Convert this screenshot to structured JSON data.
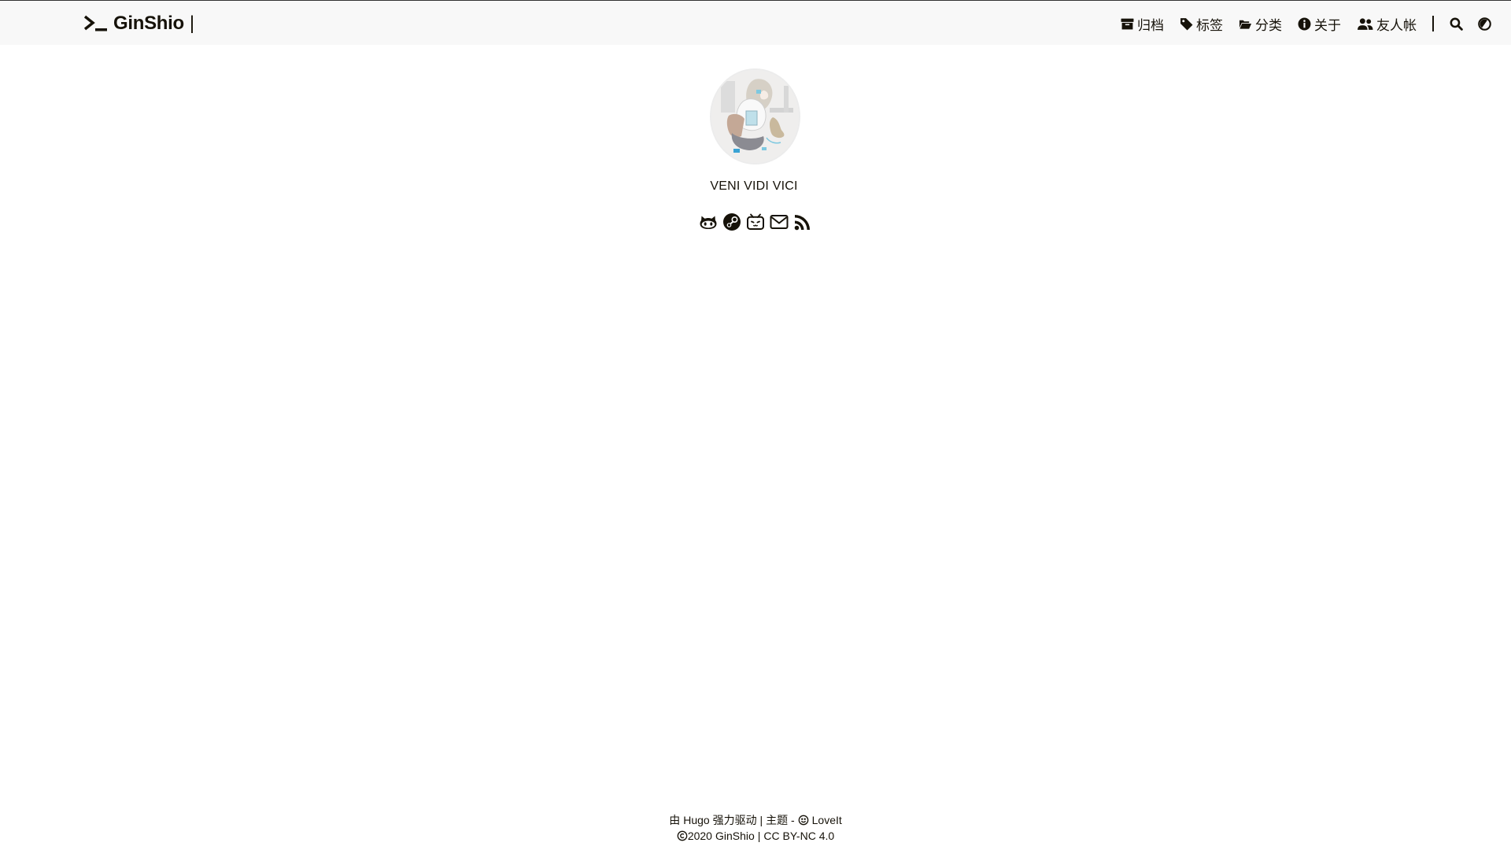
{
  "header": {
    "logo_text": "GinShio",
    "logo_caret": "|",
    "menu": [
      {
        "label": "归档",
        "icon": "archive-icon"
      },
      {
        "label": "标签",
        "icon": "tag-icon"
      },
      {
        "label": "分类",
        "icon": "folder-open-icon"
      },
      {
        "label": "关于",
        "icon": "info-icon"
      },
      {
        "label": "友人帐",
        "icon": "users-icon"
      }
    ],
    "search_icon": "search-icon",
    "theme_icon": "adjust-icon"
  },
  "profile": {
    "subtitle": "VENI VIDI VICI",
    "social": [
      {
        "name": "github",
        "icon": "github-icon"
      },
      {
        "name": "steam",
        "icon": "steam-icon"
      },
      {
        "name": "bilibili",
        "icon": "bilibili-icon"
      },
      {
        "name": "email",
        "icon": "envelope-icon"
      },
      {
        "name": "rss",
        "icon": "rss-icon"
      }
    ]
  },
  "footer": {
    "powered_prefix": "由",
    "powered_hugo": "Hugo",
    "powered_suffix": "强力驱动 | 主题 -",
    "theme_name": "LoveIt",
    "copyright_year": "2020",
    "author": "GinShio",
    "separator": "|",
    "license": "CC BY-NC 4.0"
  }
}
